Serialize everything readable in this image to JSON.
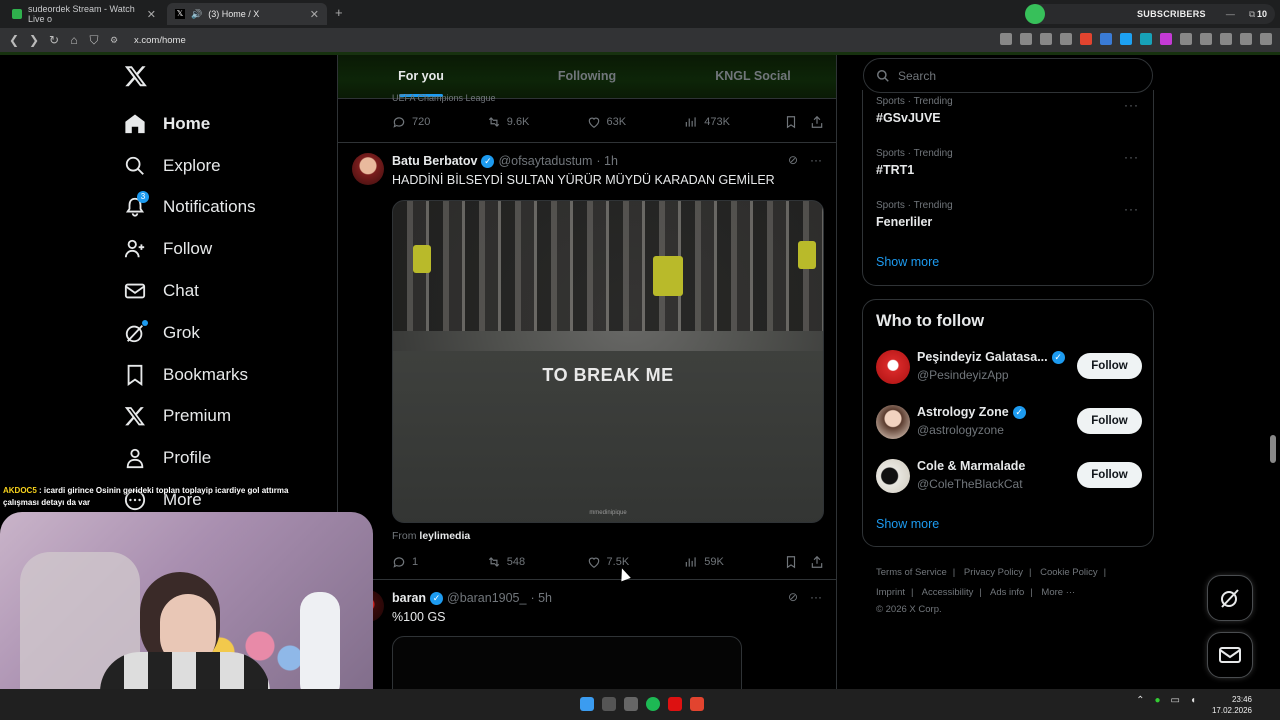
{
  "browser": {
    "tabs": [
      {
        "title": "sudeordek Stream - Watch Live o"
      },
      {
        "title": "(3) Home / X"
      }
    ],
    "url": "x.com/home",
    "subscribers": {
      "label": "SUBSCRIBERS",
      "count": "10"
    }
  },
  "nav": {
    "items": [
      {
        "label": "Home",
        "icon": "home-icon"
      },
      {
        "label": "Explore",
        "icon": "search-icon"
      },
      {
        "label": "Notifications",
        "icon": "bell-icon",
        "badge": "3"
      },
      {
        "label": "Follow",
        "icon": "person-plus-icon"
      },
      {
        "label": "Chat",
        "icon": "envelope-icon"
      },
      {
        "label": "Grok",
        "icon": "grok-icon"
      },
      {
        "label": "Bookmarks",
        "icon": "bookmark-icon"
      },
      {
        "label": "Premium",
        "icon": "x-icon"
      },
      {
        "label": "Profile",
        "icon": "person-icon"
      },
      {
        "label": "More",
        "icon": "more-circle-icon"
      }
    ]
  },
  "feed": {
    "tabs": [
      "For you",
      "Following",
      "KNGL Social"
    ],
    "active_tab": "For you",
    "previous": {
      "header": "UEFA Champions League",
      "replies": "720",
      "reposts": "9.6K",
      "likes": "63K",
      "views": "473K"
    },
    "tweets": [
      {
        "name": "Batu Berbatov",
        "handle": "@ofsaytadustum",
        "time": "· 1h",
        "text": "HADDİNİ BİLSEYDİ SULTAN YÜRÜR MÜYDÜ KARADAN GEMİLER",
        "media_overlay": "TO BREAK ME",
        "media_watermark": "mmedinipique",
        "from_label": "From",
        "from_source": "leylimedia",
        "replies": "1",
        "reposts": "548",
        "likes": "7.5K",
        "views": "59K"
      },
      {
        "name": "baran",
        "handle": "@baran1905_",
        "time": "· 5h",
        "text": "%100 GS"
      }
    ]
  },
  "sidebar": {
    "search_placeholder": "Search",
    "trends": [
      {
        "meta": "Sports · Trending",
        "title": "#GSvJUVE"
      },
      {
        "meta": "Sports · Trending",
        "title": "#TRT1"
      },
      {
        "meta": "Sports · Trending",
        "title": "Fenerliler"
      }
    ],
    "show_more": "Show more",
    "who_to_follow": {
      "title": "Who to follow",
      "accounts": [
        {
          "name": "Peşindeyiz Galatasa...",
          "handle": "@PesindeyizApp",
          "button": "Follow"
        },
        {
          "name": "Astrology Zone",
          "handle": "@astrologyzone",
          "button": "Follow"
        },
        {
          "name": "Cole & Marmalade",
          "handle": "@ColeTheBlackCat",
          "button": "Follow"
        }
      ],
      "show_more": "Show more"
    },
    "footer": {
      "links": [
        "Terms of Service",
        "Privacy Policy",
        "Cookie Policy",
        "Imprint",
        "Accessibility",
        "Ads info",
        "More ···"
      ],
      "copyright": "© 2026 X Corp."
    }
  },
  "stream_chat": {
    "user": "AKDOC5",
    "message": ": icardi girince Osinin gerideki toplan toplayip icardiye gol attırma çalışması detayı da var"
  },
  "taskbar": {
    "time": "23:46",
    "date": "17.02.2026"
  },
  "colors": {
    "accent": "#1d9bf0",
    "background": "#000000",
    "text_primary": "#e7e9ea",
    "text_secondary": "#71767b",
    "border": "#2f3336"
  }
}
